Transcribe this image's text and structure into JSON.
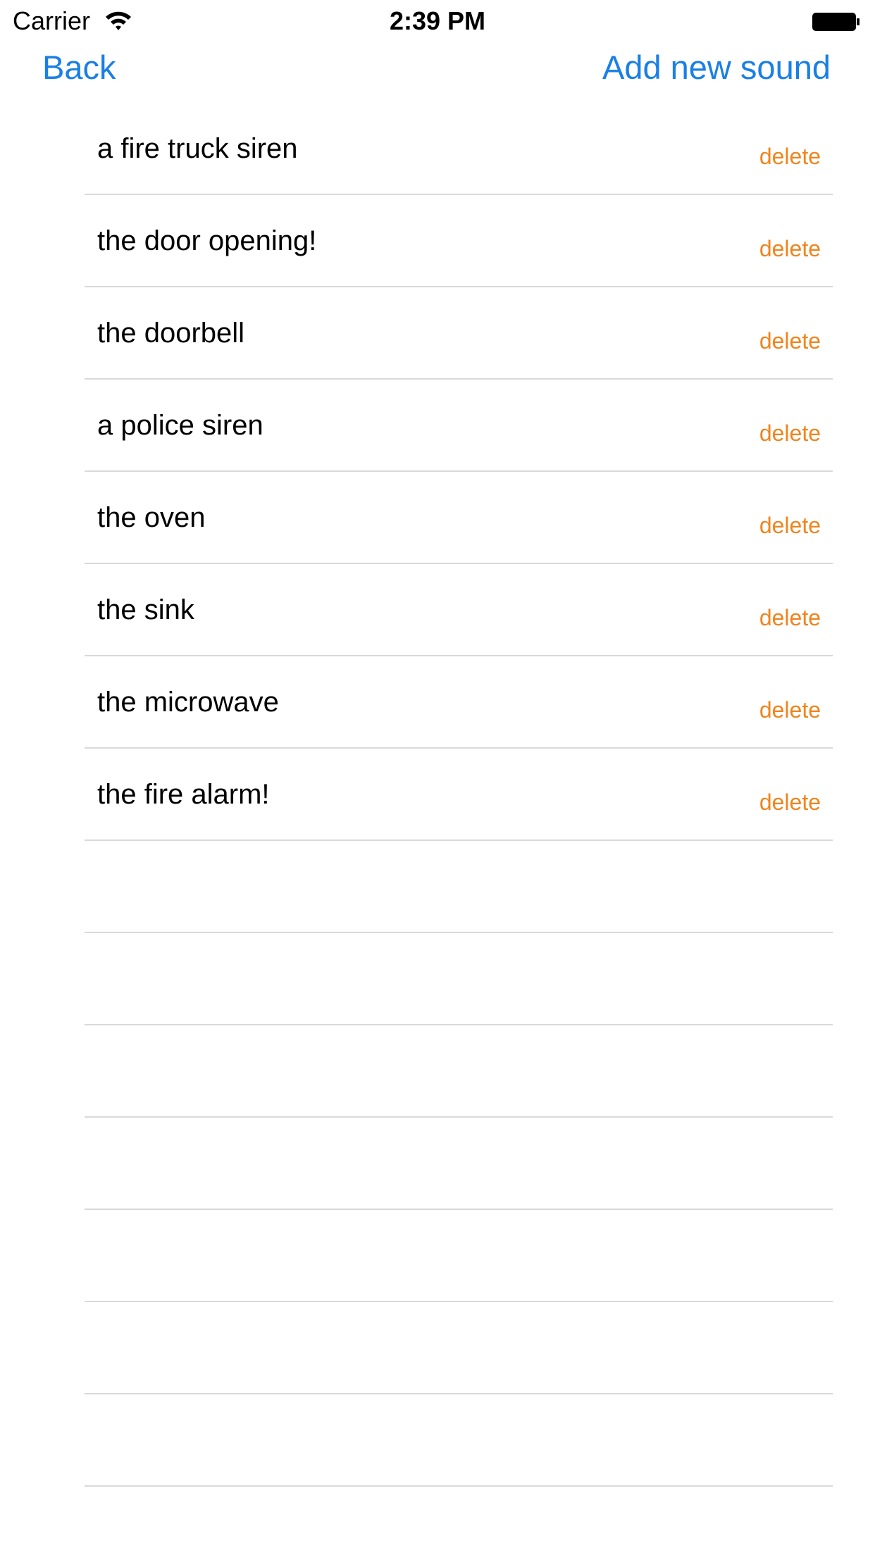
{
  "status_bar": {
    "carrier": "Carrier",
    "time": "2:39 PM",
    "wifi_icon": "wifi-icon",
    "battery_icon": "battery-icon"
  },
  "nav": {
    "back_label": "Back",
    "add_label": "Add new sound"
  },
  "colors": {
    "accent": "#1a7fe6",
    "delete": "#f0841c",
    "separator": "#d9d9d9"
  },
  "sounds": [
    {
      "label": "a fire truck siren",
      "action": "delete"
    },
    {
      "label": "the door opening!",
      "action": "delete"
    },
    {
      "label": "the doorbell",
      "action": "delete"
    },
    {
      "label": "a police siren",
      "action": "delete"
    },
    {
      "label": "the oven",
      "action": "delete"
    },
    {
      "label": "the sink",
      "action": "delete"
    },
    {
      "label": "the microwave",
      "action": "delete"
    },
    {
      "label": "the fire alarm!",
      "action": "delete"
    }
  ]
}
